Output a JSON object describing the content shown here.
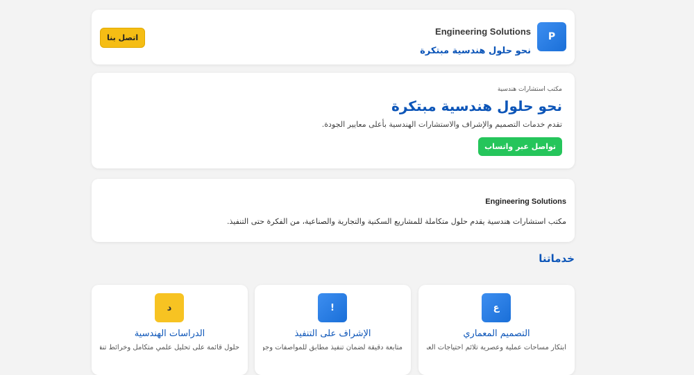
{
  "header": {
    "logo_letter": "P",
    "brand_en": "Engineering Solutions",
    "brand_ar": "نحو حلول هندسية مبتكرة",
    "contact_label": "اتصل بنا"
  },
  "hero": {
    "eyebrow": "مكتب استشارات هندسية",
    "title": "نحو حلول هندسية مبتكرة",
    "description": "تقدم خدمات التصميم والإشراف والاستشارات الهندسية بأعلى معايير الجودة.",
    "whatsapp_label": "تواصل عبر واتساب"
  },
  "about": {
    "title": "Engineering Solutions",
    "text": "مكتب استشارات هندسية يقدم حلول متكاملة للمشاريع السكنية والتجارية والصناعية، من الفكرة حتى التنفيذ."
  },
  "services": {
    "section_title": "خدماتنا",
    "items": [
      {
        "icon_glyph": "ع",
        "title": "التصميم المعماري",
        "description": "ابتكار مساحات عملية وعصرية تلائم احتياجات العميل."
      },
      {
        "icon_glyph": "!",
        "title": "الإشراف على التنفيذ",
        "description": "متابعة دقيقة لضمان تنفيذ مطابق للمواصفات وجودة"
      },
      {
        "icon_glyph": "د",
        "title": "الدراسات الهندسية",
        "description": "حلول قائمة على تحليل علمي متكامل وخرائط تنفيذ"
      }
    ]
  },
  "colors": {
    "primary": "#0c55b8",
    "accent": "#f5bd14",
    "whatsapp": "#25c55b",
    "background": "#f3f3f3"
  }
}
